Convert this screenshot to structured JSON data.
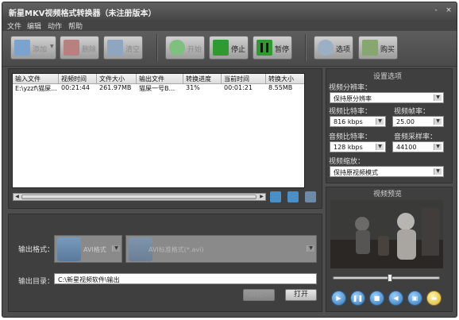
{
  "window": {
    "title": "新星MKV视频格式转换器（未注册版本）",
    "minimize": "-",
    "close": "×"
  },
  "menu": [
    "文件",
    "编辑",
    "动作",
    "帮助"
  ],
  "toolbar": {
    "add": "添加",
    "delete": "删除",
    "clear": "清空",
    "start": "开始",
    "stop": "停止",
    "pause": "暂停",
    "options": "选项",
    "buy": "购买"
  },
  "table": {
    "headers": [
      "输入文件",
      "视频时间",
      "文件大小",
      "输出文件",
      "转换进度",
      "当前时间",
      "转换大小"
    ],
    "rows": [
      [
        "E:\\yzzf\\猫屎...",
        "00:21:44",
        "261.97MB",
        "猫屎一号B...",
        "31%",
        "00:01:21",
        "8.55MB"
      ]
    ]
  },
  "output": {
    "format_label": "输出格式：",
    "format_group": "AVI格式",
    "format_value": "AVI标准格式(*.avi)",
    "dir_label": "输出目录：",
    "dir_value": "C:\\新星视频软件\\输出",
    "browse": "浏览...",
    "open": "打开"
  },
  "settings": {
    "title": "设置选项",
    "resolution_label": "视频分辨率：",
    "resolution_value": "保持原分辨率",
    "vbitrate_label": "视频比特率：",
    "vbitrate_value": "816 kbps",
    "framerate_label": "视频帧率：",
    "framerate_value": "25.00",
    "abitrate_label": "音频比特率：",
    "abitrate_value": "128 kbps",
    "samplerate_label": "音频采样率：",
    "samplerate_value": "44100",
    "scale_label": "视频缩放：",
    "scale_value": "保持原视频模式"
  },
  "preview": {
    "title": "视频预览",
    "progress": 0.53
  },
  "colors": {
    "window_bg": "#4d4d4d",
    "panel_bg": "#3f3f3f",
    "accent_blue": "#2f74b5"
  }
}
